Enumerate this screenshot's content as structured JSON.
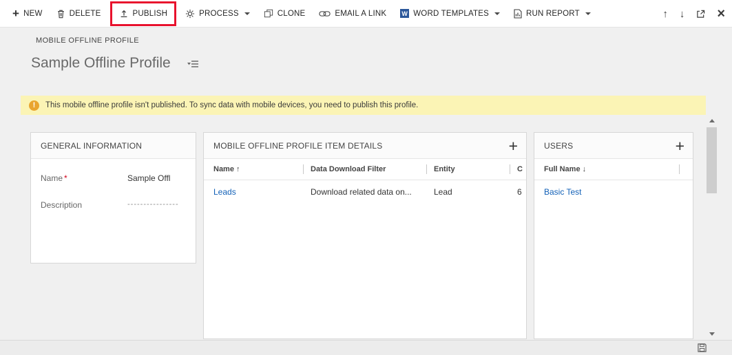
{
  "colors": {
    "link": "#1160B7",
    "warning_bg": "#FBF4B5",
    "warning_icon": "#E9A52F",
    "highlight_red": "#E8112D",
    "word_brand": "#2B579A"
  },
  "toolbar": {
    "items": [
      {
        "label": "NEW"
      },
      {
        "label": "DELETE"
      },
      {
        "label": "PUBLISH"
      },
      {
        "label": "PROCESS"
      },
      {
        "label": "CLONE"
      },
      {
        "label": "EMAIL A LINK"
      },
      {
        "label": "WORD TEMPLATES"
      },
      {
        "label": "RUN REPORT"
      }
    ]
  },
  "header": {
    "record_type": "MOBILE OFFLINE PROFILE",
    "title": "Sample Offline Profile"
  },
  "notification": {
    "icon_glyph": "!",
    "message": "This mobile offline profile isn't published. To sync data with mobile devices, you need to publish this profile."
  },
  "general": {
    "title": "GENERAL INFORMATION",
    "name_label": "Name",
    "name_required": "*",
    "name_value": "Sample Offl",
    "description_label": "Description",
    "description_value": "----------------"
  },
  "item_details": {
    "title": "MOBILE OFFLINE PROFILE ITEM DETAILS",
    "add_label": "+",
    "columns": {
      "name": "Name",
      "name_sort": "↑",
      "filter": "Data Download Filter",
      "entity": "Entity",
      "extra": "C"
    },
    "rows": [
      {
        "name": "Leads",
        "filter": "Download related data on...",
        "entity": "Lead",
        "extra": "6"
      }
    ]
  },
  "users": {
    "title": "USERS",
    "add_label": "+",
    "columns": {
      "full_name": "Full Name",
      "full_name_sort": "↓"
    },
    "rows": [
      {
        "full_name": "Basic Test"
      }
    ]
  }
}
